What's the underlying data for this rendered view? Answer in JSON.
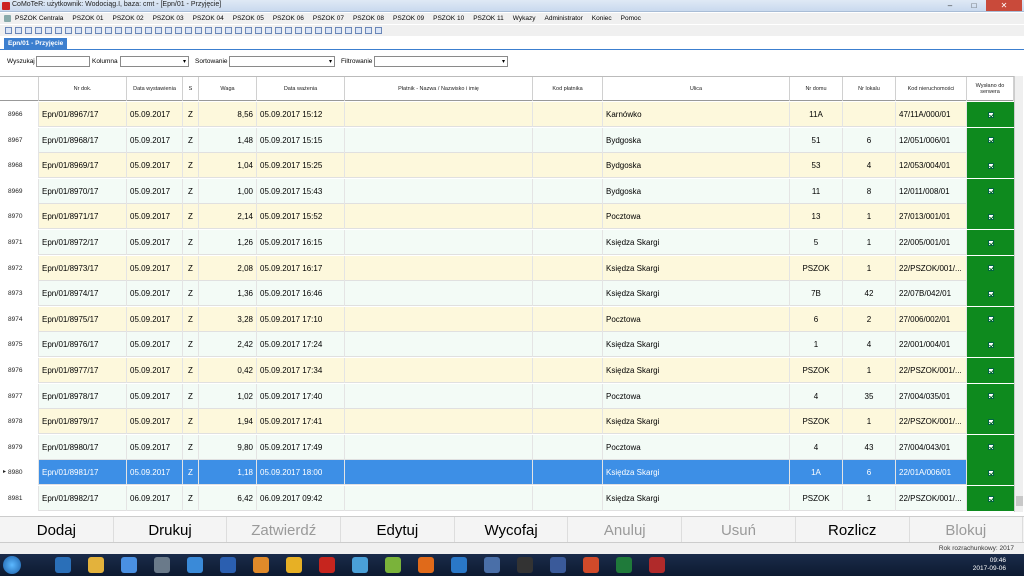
{
  "window": {
    "title": "CoMoTeR: użytkownik: Wodociąg.I, baza: cmt - [Epn/01 - Przyjęcie]",
    "min": "–",
    "max": "□",
    "close": "✕"
  },
  "menu": [
    "PSZOK Centrala",
    "PSZOK 01",
    "PSZOK 02",
    "PSZOK 03",
    "PSZOK 04",
    "PSZOK 05",
    "PSZOK 06",
    "PSZOK 07",
    "PSZOK 08",
    "PSZOK 09",
    "PSZOK 10",
    "PSZOK 11",
    "Wykazy",
    "Administrator",
    "Koniec",
    "Pomoc"
  ],
  "module_tab": "Epn/01 - Przyjęcie",
  "filters": {
    "search_label": "Wyszukaj",
    "search_value": "",
    "column_label": "Kolumna",
    "column_value": "",
    "sort_label": "Sortowanie",
    "sort_value": "",
    "filter_label": "Filtrowanie",
    "filter_value": "",
    "arrow": "▾"
  },
  "columns": [
    "",
    "Nr dok.",
    "Data wystawienia",
    "S",
    "Waga",
    "Data ważenia",
    "Płatnik - Nazwa / Nazwisko i imię",
    "Kod płatnika",
    "Ulica",
    "Nr domu",
    "Nr lokalu",
    "Kod nieruchomości",
    "Wysłano do serwera"
  ],
  "rows": [
    {
      "id": "8966",
      "nr": "Epn/01/8967/17",
      "data": "05.09.2017",
      "s": "Z",
      "waga": "8,56",
      "dataw": "05.09.2017 15:12",
      "platnik": "",
      "kod": "",
      "ulica": "Karnówko",
      "dom": "11A",
      "lokal": "",
      "kodn": "47/11A/000/01"
    },
    {
      "id": "8967",
      "nr": "Epn/01/8968/17",
      "data": "05.09.2017",
      "s": "Z",
      "waga": "1,48",
      "dataw": "05.09.2017 15:15",
      "platnik": "",
      "kod": "",
      "ulica": "Bydgoska",
      "dom": "51",
      "lokal": "6",
      "kodn": "12/051/006/01"
    },
    {
      "id": "8968",
      "nr": "Epn/01/8969/17",
      "data": "05.09.2017",
      "s": "Z",
      "waga": "1,04",
      "dataw": "05.09.2017 15:25",
      "platnik": "",
      "kod": "",
      "ulica": "Bydgoska",
      "dom": "53",
      "lokal": "4",
      "kodn": "12/053/004/01"
    },
    {
      "id": "8969",
      "nr": "Epn/01/8970/17",
      "data": "05.09.2017",
      "s": "Z",
      "waga": "1,00",
      "dataw": "05.09.2017 15:43",
      "platnik": "",
      "kod": "",
      "ulica": "Bydgoska",
      "dom": "11",
      "lokal": "8",
      "kodn": "12/011/008/01"
    },
    {
      "id": "8970",
      "nr": "Epn/01/8971/17",
      "data": "05.09.2017",
      "s": "Z",
      "waga": "2,14",
      "dataw": "05.09.2017 15:52",
      "platnik": "",
      "kod": "",
      "ulica": "Pocztowa",
      "dom": "13",
      "lokal": "1",
      "kodn": "27/013/001/01"
    },
    {
      "id": "8971",
      "nr": "Epn/01/8972/17",
      "data": "05.09.2017",
      "s": "Z",
      "waga": "1,26",
      "dataw": "05.09.2017 16:15",
      "platnik": "",
      "kod": "",
      "ulica": "Księdza Skargi",
      "dom": "5",
      "lokal": "1",
      "kodn": "22/005/001/01"
    },
    {
      "id": "8972",
      "nr": "Epn/01/8973/17",
      "data": "05.09.2017",
      "s": "Z",
      "waga": "2,08",
      "dataw": "05.09.2017 16:17",
      "platnik": "",
      "kod": "",
      "ulica": "Księdza Skargi",
      "dom": "PSZOK",
      "lokal": "1",
      "kodn": "22/PSZOK/001/..."
    },
    {
      "id": "8973",
      "nr": "Epn/01/8974/17",
      "data": "05.09.2017",
      "s": "Z",
      "waga": "1,36",
      "dataw": "05.09.2017 16:46",
      "platnik": "",
      "kod": "",
      "ulica": "Księdza Skargi",
      "dom": "7B",
      "lokal": "42",
      "kodn": "22/07B/042/01"
    },
    {
      "id": "8974",
      "nr": "Epn/01/8975/17",
      "data": "05.09.2017",
      "s": "Z",
      "waga": "3,28",
      "dataw": "05.09.2017 17:10",
      "platnik": "",
      "kod": "",
      "ulica": "Pocztowa",
      "dom": "6",
      "lokal": "2",
      "kodn": "27/006/002/01"
    },
    {
      "id": "8975",
      "nr": "Epn/01/8976/17",
      "data": "05.09.2017",
      "s": "Z",
      "waga": "2,42",
      "dataw": "05.09.2017 17:24",
      "platnik": "",
      "kod": "",
      "ulica": "Księdza Skargi",
      "dom": "1",
      "lokal": "4",
      "kodn": "22/001/004/01"
    },
    {
      "id": "8976",
      "nr": "Epn/01/8977/17",
      "data": "05.09.2017",
      "s": "Z",
      "waga": "0,42",
      "dataw": "05.09.2017 17:34",
      "platnik": "",
      "kod": "",
      "ulica": "Księdza Skargi",
      "dom": "PSZOK",
      "lokal": "1",
      "kodn": "22/PSZOK/001/..."
    },
    {
      "id": "8977",
      "nr": "Epn/01/8978/17",
      "data": "05.09.2017",
      "s": "Z",
      "waga": "1,02",
      "dataw": "05.09.2017 17:40",
      "platnik": "",
      "kod": "",
      "ulica": "Pocztowa",
      "dom": "4",
      "lokal": "35",
      "kodn": "27/004/035/01"
    },
    {
      "id": "8978",
      "nr": "Epn/01/8979/17",
      "data": "05.09.2017",
      "s": "Z",
      "waga": "1,94",
      "dataw": "05.09.2017 17:41",
      "platnik": "",
      "kod": "",
      "ulica": "Księdza Skargi",
      "dom": "PSZOK",
      "lokal": "1",
      "kodn": "22/PSZOK/001/..."
    },
    {
      "id": "8979",
      "nr": "Epn/01/8980/17",
      "data": "05.09.2017",
      "s": "Z",
      "waga": "9,80",
      "dataw": "05.09.2017 17:49",
      "platnik": "",
      "kod": "",
      "ulica": "Pocztowa",
      "dom": "4",
      "lokal": "43",
      "kodn": "27/004/043/01"
    },
    {
      "id": "8980",
      "nr": "Epn/01/8981/17",
      "data": "05.09.2017",
      "s": "Z",
      "waga": "1,18",
      "dataw": "05.09.2017 18:00",
      "platnik": "",
      "kod": "",
      "ulica": "Księdza Skargi",
      "dom": "1A",
      "lokal": "6",
      "kodn": "22/01A/006/01",
      "selected": true
    },
    {
      "id": "8981",
      "nr": "Epn/01/8982/17",
      "data": "06.09.2017",
      "s": "Z",
      "waga": "6,42",
      "dataw": "06.09.2017 09:42",
      "platnik": "",
      "kod": "",
      "ulica": "Księdza Skargi",
      "dom": "PSZOK",
      "lokal": "1",
      "kodn": "22/PSZOK/001/..."
    }
  ],
  "selected_marker": "▸",
  "actions": [
    {
      "label": "Dodaj",
      "enabled": true
    },
    {
      "label": "Drukuj",
      "enabled": true
    },
    {
      "label": "Zatwierdź",
      "enabled": false
    },
    {
      "label": "Edytuj",
      "enabled": true
    },
    {
      "label": "Wycofaj",
      "enabled": true
    },
    {
      "label": "Anuluj",
      "enabled": false
    },
    {
      "label": "Usuń",
      "enabled": false
    },
    {
      "label": "Rozlicz",
      "enabled": true
    },
    {
      "label": "Blokuj",
      "enabled": false
    }
  ],
  "status": {
    "year": "Rok rozrachunkowy: 2017"
  },
  "clock": {
    "time": "09:46",
    "date": "2017-09-06"
  },
  "colors": {
    "selected_row": "#3d8fe6",
    "sent_cell": "#0e8a1e",
    "even_row": "#fdf8dc",
    "odd_row": "#f3fbf6",
    "tab": "#3c7fcf"
  },
  "taskbar_apps": [
    "start-icon",
    "explorer-icon",
    "folder-icon",
    "network-icon",
    "tools-icon",
    "monitor-icon",
    "word-icon",
    "media-icon",
    "chrome-icon",
    "pdf-icon",
    "cloud-icon",
    "paint-icon",
    "firefox-icon",
    "outlook-icon",
    "sheet-icon",
    "terminal-icon",
    "cubes-icon",
    "powerpoint-icon",
    "excel-icon",
    "comoter-icon"
  ]
}
